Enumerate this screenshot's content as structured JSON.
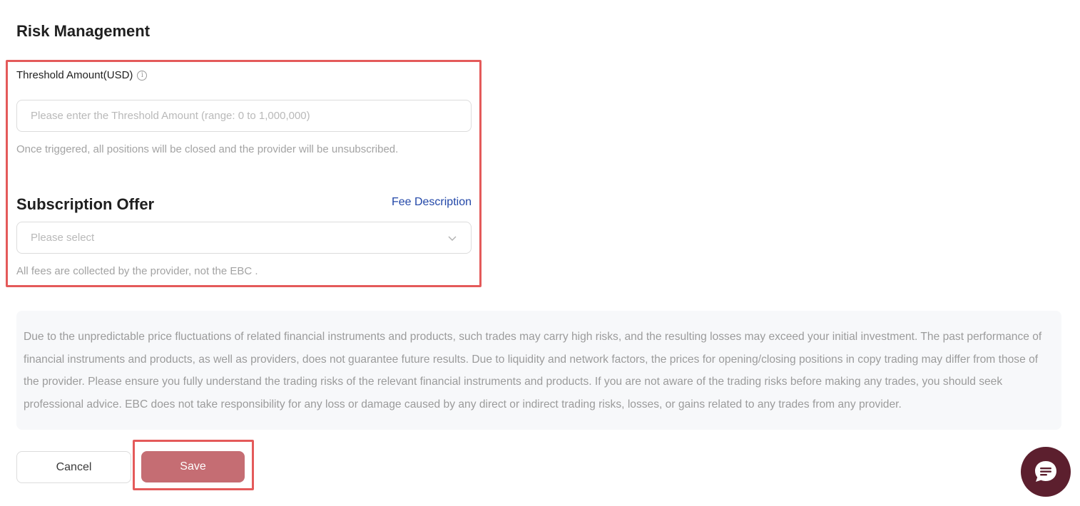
{
  "risk": {
    "title": "Risk Management",
    "threshold_label": "Threshold Amount(USD)",
    "threshold_value": "",
    "threshold_placeholder": "Please enter the Threshold Amount (range: 0 to 1,000,000)",
    "threshold_hint": "Once triggered, all positions will be closed and the provider will be unsubscribed."
  },
  "subscription": {
    "title": "Subscription Offer",
    "fee_link": "Fee Description",
    "select_placeholder": "Please select",
    "hint": "All fees are collected by the provider, not the EBC ."
  },
  "disclaimer": "Due to the unpredictable price fluctuations of related financial instruments and products, such trades may carry high risks, and the resulting losses may exceed your initial investment. The past performance of financial instruments and products, as well as providers, does not guarantee future results. Due to liquidity and network factors, the prices for opening/closing positions in copy trading may differ from those of the provider. Please ensure you fully understand the trading risks of the relevant financial instruments and products. If you are not aware of the trading risks before making any trades, you should seek professional advice. EBC does not take responsibility for any loss or damage caused by any direct or indirect trading risks, losses, or gains related to any trades from any provider.",
  "actions": {
    "cancel_label": "Cancel",
    "save_label": "Save"
  },
  "icons": {
    "info": "info-circle-icon",
    "chevron": "chevron-down-icon",
    "chat": "chat-bubble-icon"
  },
  "colors": {
    "highlight": "#e45a5a",
    "save_button": "#c56d73",
    "link": "#2247a8",
    "chat_button": "#5c1f2e"
  }
}
